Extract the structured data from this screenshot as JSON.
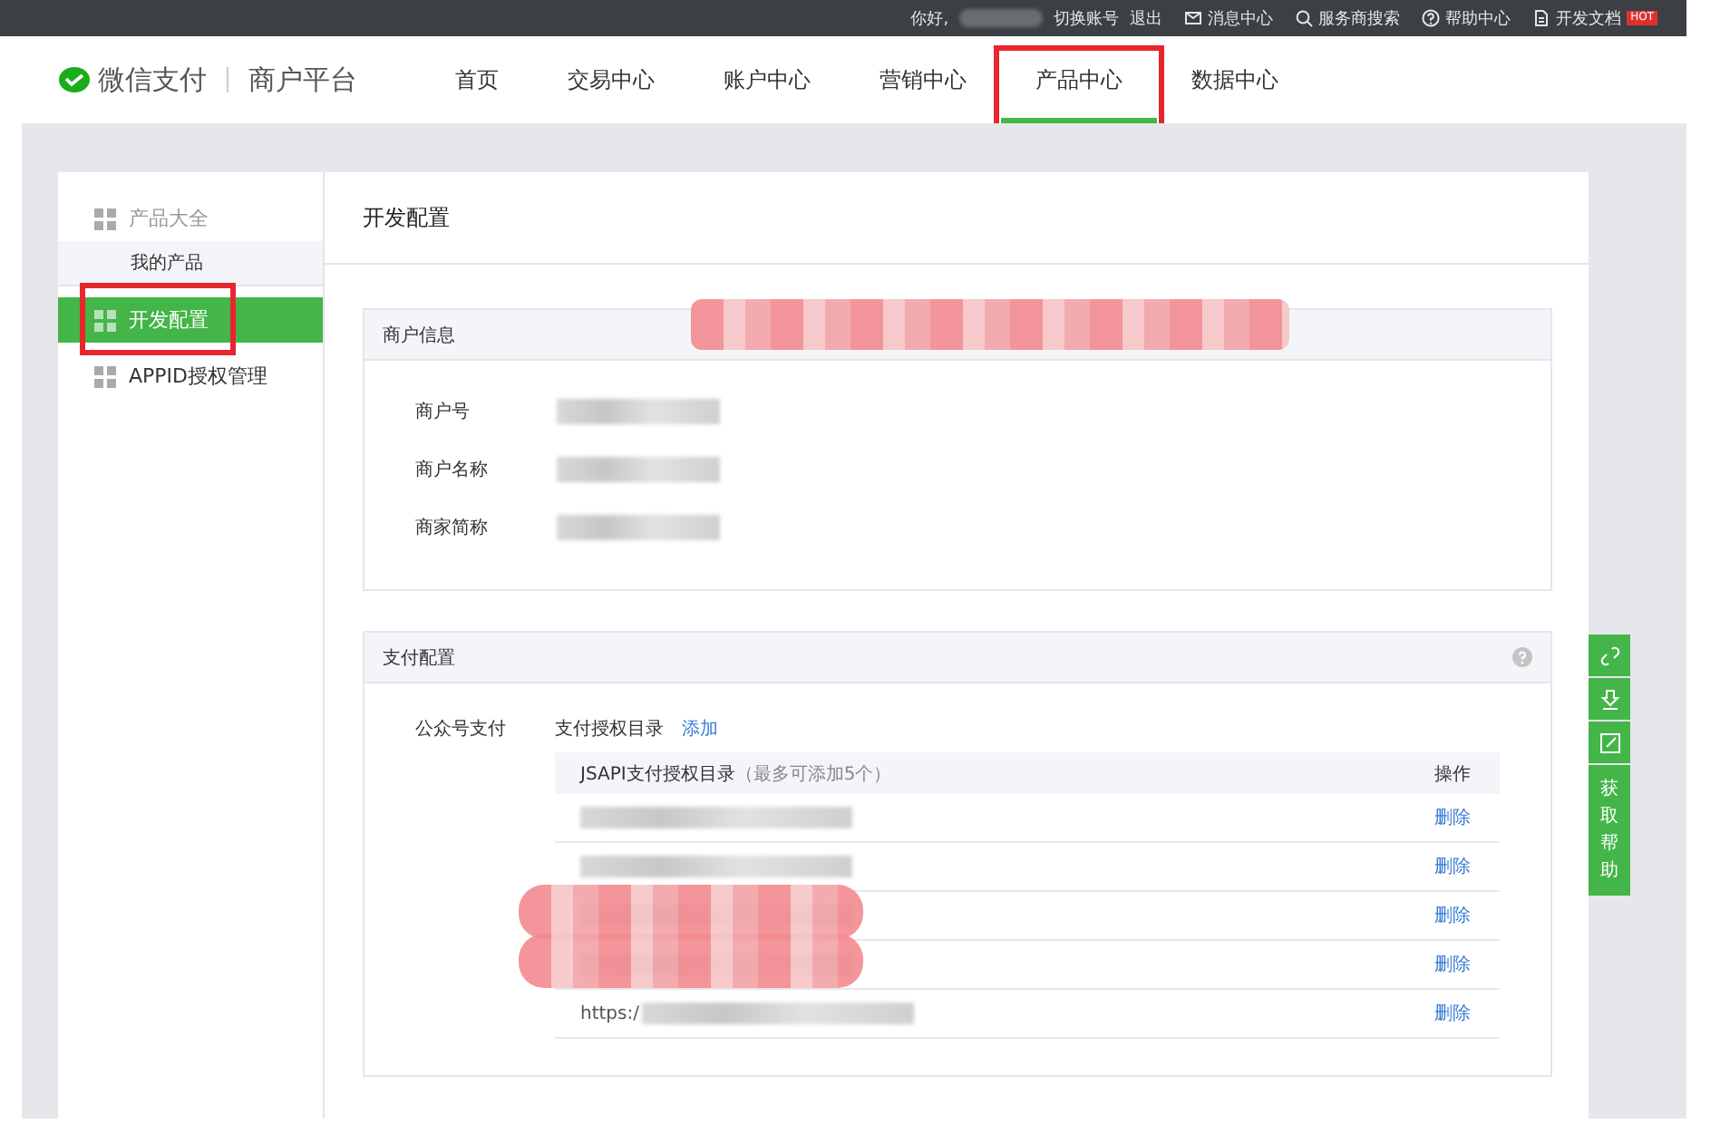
{
  "top_bar": {
    "greeting": "你好,",
    "greeting_redacted": true,
    "links": [
      "切换账号",
      "退出"
    ],
    "tools": [
      {
        "kind": "mail",
        "label": "消息中心"
      },
      {
        "kind": "search",
        "label": "服务商搜索"
      },
      {
        "kind": "help",
        "label": "帮助中心"
      },
      {
        "kind": "doc",
        "label": "开发文档",
        "badge": "HOT"
      }
    ]
  },
  "header": {
    "brand": "微信支付",
    "subtitle": "商户平台",
    "nav": [
      {
        "label": "首页",
        "selected": false,
        "highlighted": false
      },
      {
        "label": "交易中心",
        "selected": false,
        "highlighted": false
      },
      {
        "label": "账户中心",
        "selected": false,
        "highlighted": false
      },
      {
        "label": "营销中心",
        "selected": false,
        "highlighted": false
      },
      {
        "label": "产品中心",
        "selected": true,
        "highlighted": true
      },
      {
        "label": "数据中心",
        "selected": false,
        "highlighted": false
      }
    ]
  },
  "sidebar": {
    "items": [
      {
        "kind": "group",
        "label": "产品大全",
        "selected": false,
        "highlighted": false,
        "children": [
          {
            "label": "我的产品",
            "selected": false
          }
        ]
      },
      {
        "kind": "item",
        "label": "开发配置",
        "selected": true,
        "highlighted": true
      },
      {
        "kind": "item",
        "label": "APPID授权管理",
        "selected": false,
        "highlighted": false
      }
    ]
  },
  "page_title": "开发配置",
  "merchant_info": {
    "title": "商户信息",
    "scribbled": true,
    "fields": [
      {
        "label": "商户号",
        "redacted": true
      },
      {
        "label": "商户名称",
        "redacted": true
      },
      {
        "label": "商家简称",
        "redacted": true
      }
    ]
  },
  "payment_config": {
    "title": "支付配置",
    "label": "公众号支付",
    "directory_label": "支付授权目录",
    "add_link": "添加",
    "table": {
      "columns": [
        "JSAPI支付授权目录",
        "（最多可添加5个）",
        "操作"
      ],
      "rows": [
        {
          "redacted": true,
          "scribbled": false,
          "action": "删除"
        },
        {
          "redacted": true,
          "scribbled": false,
          "action": "删除"
        },
        {
          "redacted": true,
          "scribbled": true,
          "action": "删除"
        },
        {
          "redacted": true,
          "scribbled": true,
          "action": "删除"
        },
        {
          "value": "https:/",
          "redacted": true,
          "scribbled": false,
          "action": "删除"
        }
      ]
    }
  },
  "help_bar": {
    "tools": [
      {
        "kind": "link"
      },
      {
        "kind": "download"
      },
      {
        "kind": "edit"
      }
    ],
    "label": "获取帮助"
  }
}
